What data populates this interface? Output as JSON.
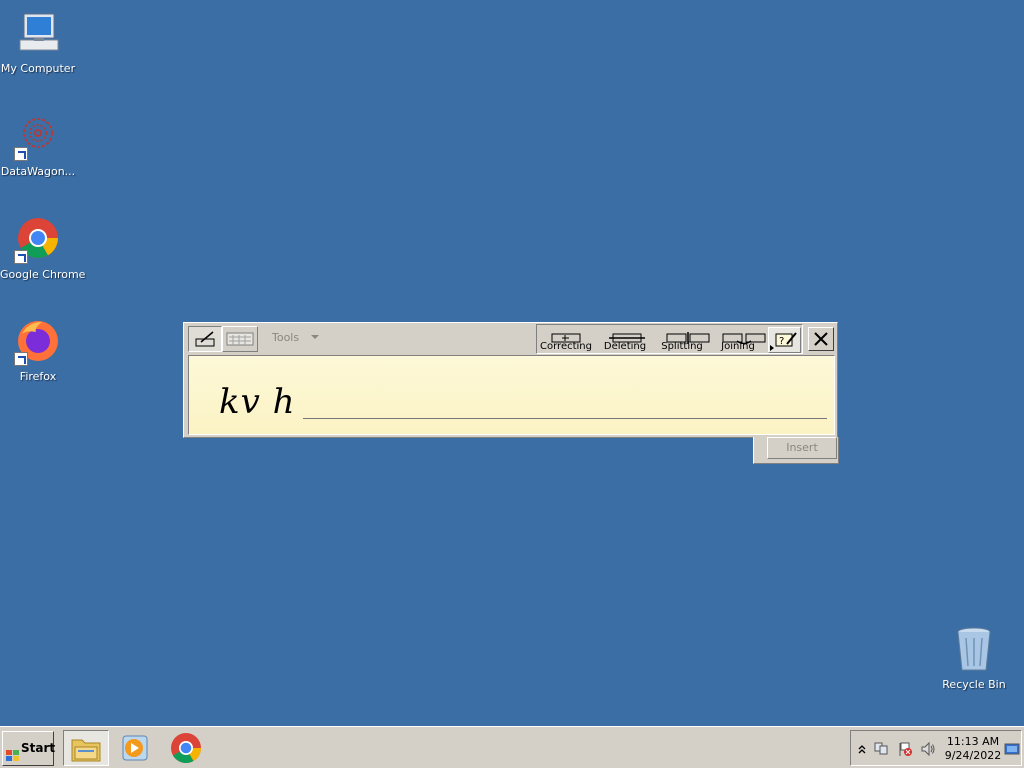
{
  "desktop": {
    "icons": [
      {
        "label": "My Computer"
      },
      {
        "label": "DataWagon..."
      },
      {
        "label": "Google Chrome"
      },
      {
        "label": "Firefox"
      },
      {
        "label": "Recycle Bin"
      }
    ]
  },
  "input_panel": {
    "tools_label": "Tools",
    "gestures": [
      {
        "label": "Correcting"
      },
      {
        "label": "Deleting"
      },
      {
        "label": "Splitting"
      },
      {
        "label": "Joining"
      }
    ],
    "ink_text": "kv  h",
    "insert_label": "Insert"
  },
  "taskbar": {
    "start_label": "Start",
    "clock_time": "11:13 AM",
    "clock_date": "9/24/2022"
  },
  "colors": {
    "desktop": "#3a6ea5",
    "chrome": "#d4d0c8",
    "writing_area": "#fcf3c4"
  }
}
